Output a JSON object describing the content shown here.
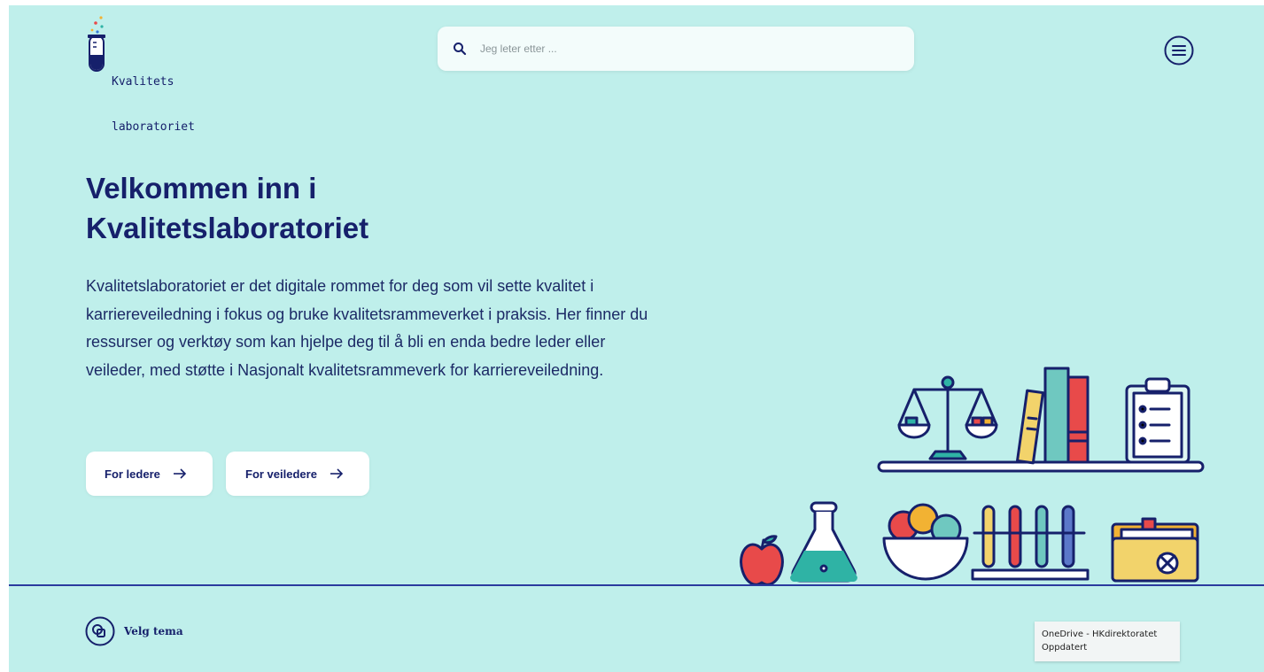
{
  "brand": {
    "logo_line1": "Kvalitets",
    "logo_line2": "laboratoriet"
  },
  "search": {
    "placeholder": "Jeg leter etter ..."
  },
  "header": {
    "menu_icon": "hamburger-menu-icon"
  },
  "hero": {
    "title_line1": "Velkommen inn i",
    "title_line2": "Kvalitetslaboratoriet",
    "body": "Kvalitetslaboratoriet er det digitale rommet for deg som vil sette kvalitet i karriereveiledning i fokus og bruke kvalitetsrammeverket i praksis. Her finner du ressurser og verktøy som kan hjelpe deg til å bli en enda bedre leder eller veileder, med støtte i Nasjonalt kvalitetsrammeverk for karriereveiledning."
  },
  "buttons": {
    "leder_label": "For ledere",
    "veileder_label": "For veiledere"
  },
  "footer": {
    "theme_label": "Velg tema"
  },
  "notification": {
    "line1": "OneDrive - HKdirektoratet",
    "line2": "Oppdatert"
  },
  "colors": {
    "background": "#bfefeb",
    "primary": "#16206b",
    "accent_line": "#2b3a9e"
  }
}
